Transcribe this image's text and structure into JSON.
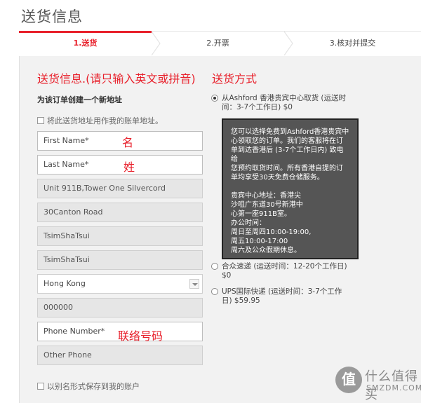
{
  "page_title": "送货信息",
  "steps": [
    {
      "label": "1.送货"
    },
    {
      "label": "2.开票"
    },
    {
      "label": "3.核对并提交"
    }
  ],
  "address": {
    "section_title": "送货信息.(请只输入英文或拼音)",
    "subheading": "为该订单创建一个新地址",
    "billing_checkbox_label": "将此送货地址用作我的账单地址。",
    "fields": {
      "first_name_placeholder": "First Name*",
      "first_name_note": "名",
      "last_name_placeholder": "Last Name*",
      "last_name_note": "姓",
      "address1_value": "Unit 911B,Tower One Silvercord",
      "address2_value": "30Canton Road",
      "city_value": "TsimShaTsui",
      "district_value": "TsimShaTsui",
      "country_value": "Hong Kong",
      "postcode_value": "000000",
      "phone_placeholder": "Phone Number*",
      "phone_note": "联络号码",
      "other_phone_placeholder": "Other Phone"
    },
    "save_alias_label": "以别名形式保存到我的账户"
  },
  "shipping": {
    "section_title": "送货方式",
    "options": [
      {
        "line1": "从Ashford 香港贵宾中心取货 (运送时",
        "line2": "间：3-7个工作日) $0",
        "selected": true
      },
      {
        "line1": "合众速递 (运送时间：12-20个工作日)",
        "line2": "$0",
        "selected": false
      },
      {
        "line1": "UPS国际快递 (运送时间：3-7个工作",
        "line2": "日) $59.95",
        "selected": false
      }
    ],
    "info_para1": [
      "您可以选择免费到Ashford香港贵宾中",
      "心领取您的订单。我们的客服将在订",
      "单到达香港后 (3-7个工作日内) 致电给",
      "您预约取货时间。所有香港自提的订",
      "单均享受30天免费仓储服务。"
    ],
    "info_para2": [
      "贵宾中心地址：香港尖",
      "沙咀广东道30号新港中",
      "心第一座911B室。",
      "办公时间：",
      "周日至周四10:00-19:00,",
      "周五10:00-17:00",
      "周六及公众假期休息。"
    ]
  },
  "watermark": {
    "logo": "值",
    "text": "什么值得买",
    "sub": "SMZDM.COM"
  }
}
